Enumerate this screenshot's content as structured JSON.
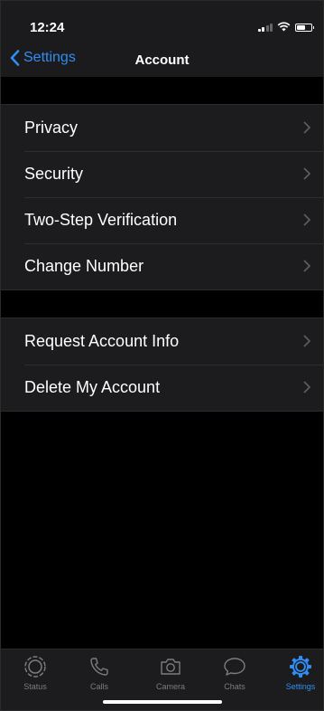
{
  "status_bar": {
    "time": "12:24"
  },
  "nav": {
    "back_label": "Settings",
    "title": "Account"
  },
  "groups": [
    {
      "items": [
        {
          "label": "Privacy"
        },
        {
          "label": "Security"
        },
        {
          "label": "Two-Step Verification"
        },
        {
          "label": "Change Number"
        }
      ]
    },
    {
      "items": [
        {
          "label": "Request Account Info"
        },
        {
          "label": "Delete My Account"
        }
      ]
    }
  ],
  "tabs": [
    {
      "label": "Status",
      "icon": "status-icon"
    },
    {
      "label": "Calls",
      "icon": "phone-icon"
    },
    {
      "label": "Camera",
      "icon": "camera-icon"
    },
    {
      "label": "Chats",
      "icon": "chat-bubble-icon"
    },
    {
      "label": "Settings",
      "icon": "gear-icon",
      "active": true
    }
  ],
  "colors": {
    "accent": "#2f8ef3",
    "background": "#000000",
    "cell": "#1c1c1e",
    "inactive_tab": "#7c7c80"
  }
}
